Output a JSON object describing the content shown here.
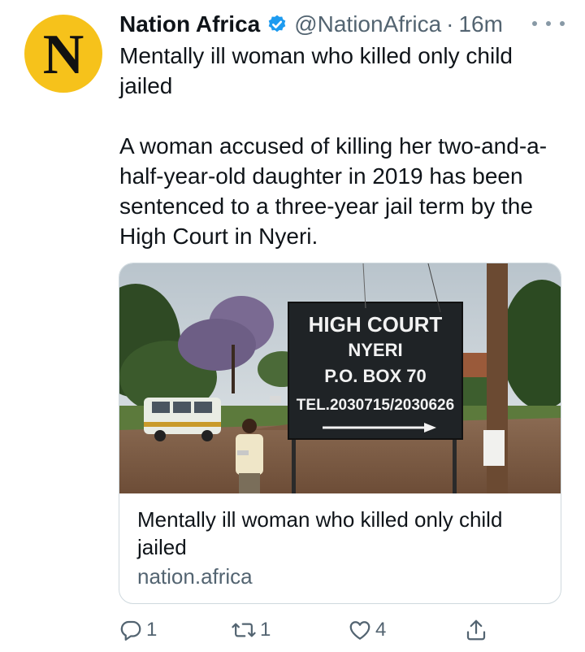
{
  "tweet": {
    "avatar_letter": "N",
    "name": "Nation Africa",
    "handle": "@NationAfrica",
    "separator": "·",
    "time": "16m",
    "text_line1": "Mentally ill woman who killed only child jailed",
    "text_line2": "A woman accused of killing her two-and-a-half-year-old daughter in 2019 has been sentenced to a three-year jail term by the High Court in Nyeri."
  },
  "card": {
    "sign": {
      "line1": "HIGH COURT",
      "line2": "NYERI",
      "line3": "P.O. BOX 70",
      "line4": "TEL.2030715/2030626"
    },
    "title": "Mentally ill woman who killed only child jailed",
    "domain": "nation.africa"
  },
  "actions": {
    "reply_count": "1",
    "retweet_count": "1",
    "like_count": "4"
  },
  "colors": {
    "avatar_bg": "#f6c21b",
    "verified": "#1d9bf0",
    "secondary_text": "#536471"
  },
  "icons": [
    "verified-badge-icon",
    "more-icon",
    "reply-icon",
    "retweet-icon",
    "like-icon",
    "share-icon"
  ]
}
